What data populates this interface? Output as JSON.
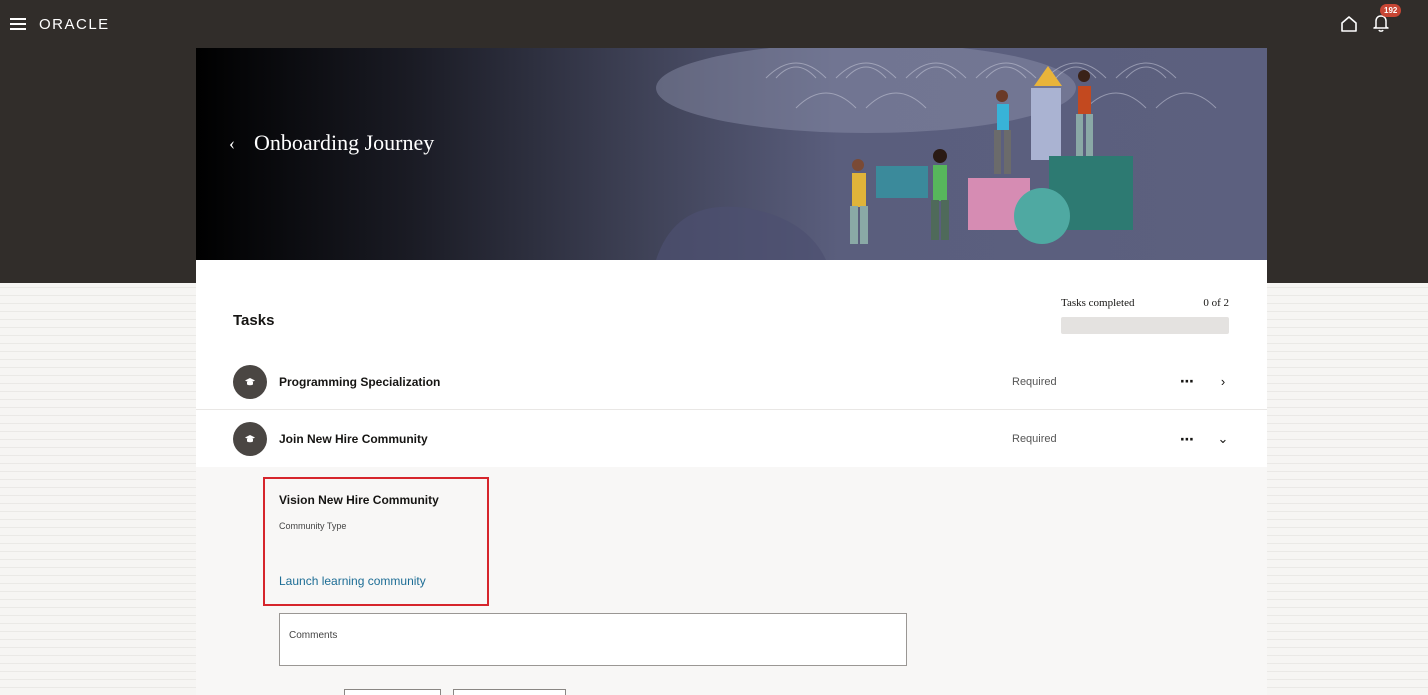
{
  "header": {
    "logo": "ORACLE",
    "notification_count": "192"
  },
  "hero": {
    "title": "Onboarding Journey"
  },
  "tasks": {
    "title": "Tasks",
    "completed_label": "Tasks completed",
    "completed_value": "0 of 2",
    "progress_fraction": 0
  },
  "task_list": [
    {
      "name": "Programming Specialization",
      "status": "Required",
      "expanded": false
    },
    {
      "name": "Join New Hire Community",
      "status": "Required",
      "expanded": true
    }
  ],
  "community": {
    "title": "Vision New Hire Community",
    "type_label": "Community Type",
    "link_label": "Launch learning community"
  },
  "comments": {
    "label": "Comments"
  },
  "icons": {
    "menu": "hamburger-icon",
    "home": "home-icon",
    "notifications": "bell-icon",
    "back": "chevron-left-icon",
    "task": "graduation-cap-icon",
    "more": "more-horizontal-icon",
    "collapsed": "chevron-right-icon",
    "expanded": "chevron-down-icon"
  },
  "colors": {
    "header_bg": "#312d2a",
    "badge": "#c74634",
    "link": "#1d6d95",
    "highlight": "#d6252c"
  }
}
